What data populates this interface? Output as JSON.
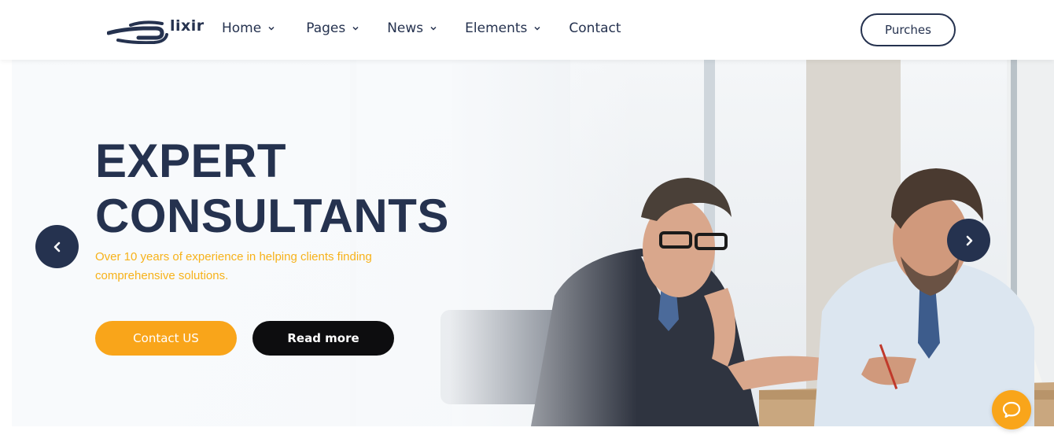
{
  "brand": {
    "name": "lixir",
    "logo_icon": "elixir-logo-mark"
  },
  "nav": {
    "items": [
      {
        "label": "Home",
        "has_dropdown": true
      },
      {
        "label": "Pages",
        "has_dropdown": true
      },
      {
        "label": "News",
        "has_dropdown": true
      },
      {
        "label": "Elements",
        "has_dropdown": true
      },
      {
        "label": "Contact",
        "has_dropdown": false
      }
    ],
    "cta_label": "Purches"
  },
  "hero": {
    "title_line1": "EXPERT",
    "title_line2": "CONSULTANTS",
    "subtitle": "Over 10 years of experience in helping clients finding comprehensive solutions.",
    "primary_button": "Contact US",
    "secondary_button": "Read more",
    "prev_icon": "chevron-left-icon",
    "next_icon": "chevron-right-icon",
    "image_subject": "two businessmen consulting at a table"
  },
  "chat": {
    "icon": "chat-bubble-icon"
  },
  "colors": {
    "navy": "#25324f",
    "accent_orange": "#f9a51a",
    "subtitle_yellow": "#f7b21a",
    "black_button": "#0d0d0f"
  }
}
